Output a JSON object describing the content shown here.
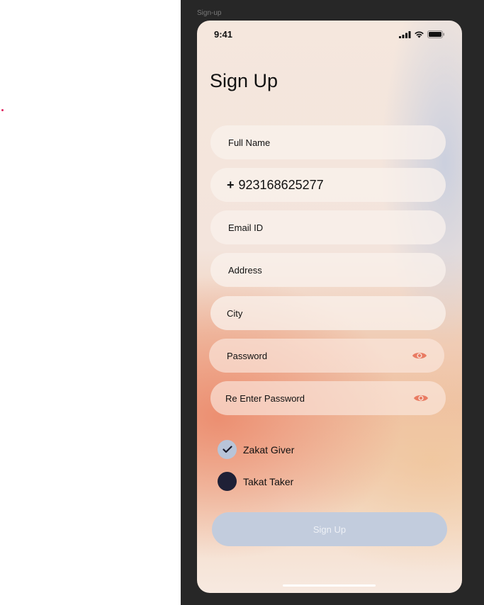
{
  "frame_label": "Sign-up",
  "status_bar": {
    "time": "9:41",
    "icons": [
      "signal-icon",
      "wifi-icon",
      "battery-icon"
    ]
  },
  "title": "Sign Up",
  "fields": {
    "full_name": "Full Name",
    "phone_prefix": "+",
    "phone": "923168625277",
    "email": "Email ID",
    "address": "Address",
    "city": "City",
    "password": "Password",
    "re_password": "Re Enter Password"
  },
  "roles": {
    "giver": {
      "label": "Zakat Giver",
      "checked": true
    },
    "taker": {
      "label": "Takat Taker",
      "checked": false
    }
  },
  "signup_button": "Sign Up",
  "colors": {
    "accent": "#e97b62",
    "button": "#c2ccdd",
    "radio_dark": "#1f2036",
    "canvas": "#272727"
  }
}
